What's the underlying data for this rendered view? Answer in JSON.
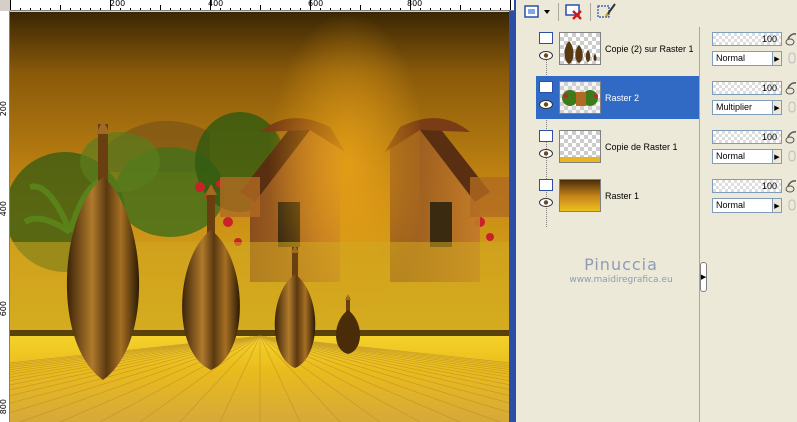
{
  "rulers": {
    "top_labels": [
      "200",
      "400",
      "600",
      "800"
    ],
    "left_labels": [
      "200",
      "400",
      "600",
      "800"
    ]
  },
  "toolbar": {
    "icons": [
      "new-layer-icon",
      "dropdown-arrow-icon",
      "delete-layer-icon",
      "edit-layer-icon"
    ]
  },
  "layers": [
    {
      "name": "Copie (2) sur Raster 1",
      "opacity": "100",
      "blend": "Normal",
      "selected": false,
      "thumb": "lutes"
    },
    {
      "name": "Raster 2",
      "opacity": "100",
      "blend": "Multiplier",
      "selected": true,
      "thumb": "landscape"
    },
    {
      "name": "Copie de Raster 1",
      "opacity": "100",
      "blend": "Normal",
      "selected": false,
      "thumb": "gradient-thin"
    },
    {
      "name": "Raster 1",
      "opacity": "100",
      "blend": "Normal",
      "selected": false,
      "thumb": "gradient"
    }
  ],
  "watermark": {
    "title": "Pinuccia",
    "url": "www.maidiregrafica.eu"
  },
  "colors": {
    "selection": "#316ac5",
    "panel_bg": "#ece9d8",
    "accent_border": "#2b4fa8",
    "watermark": "#8f9bb7"
  }
}
